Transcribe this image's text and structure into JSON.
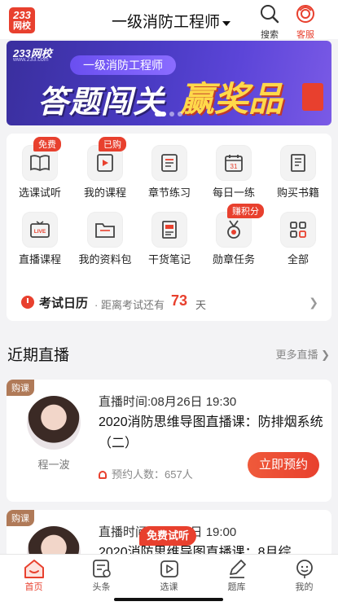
{
  "header": {
    "logo_line1": "233",
    "logo_line2": "网校",
    "title": "一级消防工程师",
    "search_label": "搜索",
    "service_label": "客服"
  },
  "banner": {
    "logo": "233网校",
    "site": "www.233.com",
    "pill": "一级消防工程师",
    "headline_a": "答题闯关",
    "headline_b": "赢奖品"
  },
  "grid": {
    "items": [
      {
        "label": "选课试听",
        "badge": "免费",
        "icon": "book-open-icon"
      },
      {
        "label": "我的课程",
        "badge": "已购",
        "icon": "play-video-icon"
      },
      {
        "label": "章节练习",
        "badge": "",
        "icon": "list-doc-icon"
      },
      {
        "label": "每日一练",
        "badge": "",
        "icon": "calendar-icon"
      },
      {
        "label": "购买书籍",
        "badge": "",
        "icon": "books-icon"
      },
      {
        "label": "直播课程",
        "badge": "",
        "icon": "live-tv-icon"
      },
      {
        "label": "我的资料包",
        "badge": "",
        "icon": "folder-icon"
      },
      {
        "label": "干货笔记",
        "badge": "",
        "icon": "notes-icon"
      },
      {
        "label": "勋章任务",
        "badge": "赚积分",
        "icon": "medal-icon"
      },
      {
        "label": "全部",
        "badge": "",
        "icon": "grid-icon"
      }
    ],
    "calendar_num": "31",
    "live_text": "LIVE"
  },
  "exam": {
    "title": "考试日历",
    "prefix": "· 距离考试还有",
    "days": "73",
    "unit": "天"
  },
  "section": {
    "title": "近期直播",
    "more": "更多直播"
  },
  "live_cards": [
    {
      "tag": "购课",
      "time": "直播时间:08月26日 19:30",
      "title": "2020消防思维导图直播课：防排烟系统（二）",
      "teacher": "程一波",
      "booked": "预约人数：657人",
      "button": "立即预约"
    },
    {
      "tag": "购课",
      "time": "直播时间:08月31日 19:00",
      "title": "2020消防思维导图直播课：8月综"
    }
  ],
  "trial_badge": "免费试听",
  "tabs": [
    {
      "label": "首页",
      "icon": "home-icon"
    },
    {
      "label": "头条",
      "icon": "news-icon"
    },
    {
      "label": "选课",
      "icon": "course-play-icon"
    },
    {
      "label": "题库",
      "icon": "pencil-icon"
    },
    {
      "label": "我的",
      "icon": "profile-icon"
    }
  ],
  "colors": {
    "accent": "#e8402e",
    "banner_bg": "#4a3bc4",
    "tag_brown": "#b07a58"
  }
}
